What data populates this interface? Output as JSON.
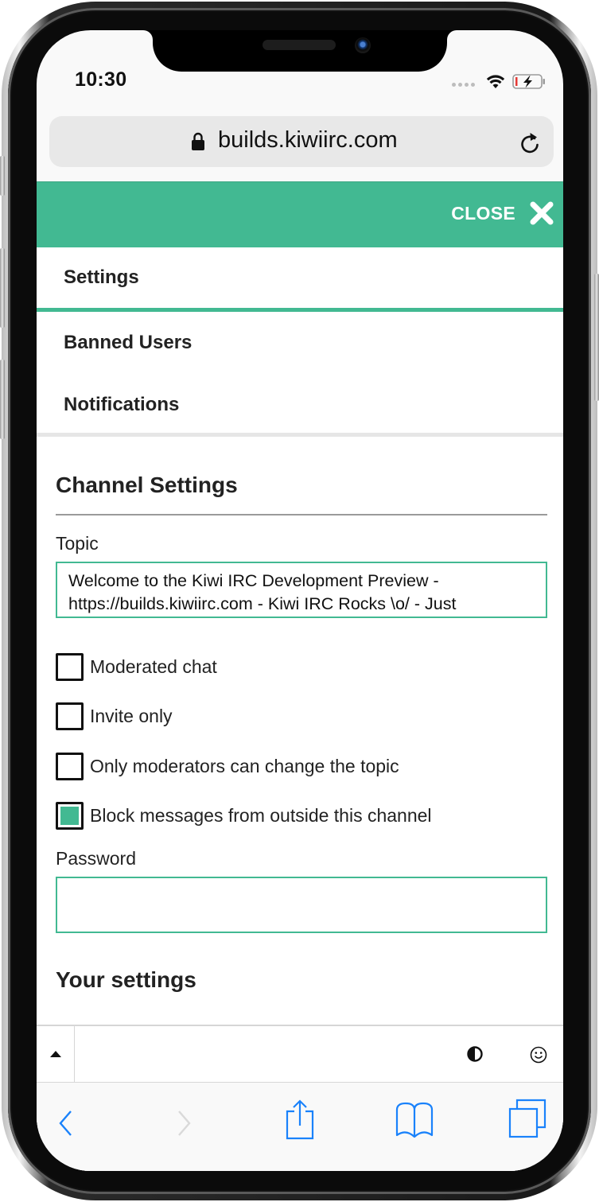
{
  "status_bar": {
    "time": "10:30"
  },
  "browser": {
    "url": "builds.kiwiirc.com",
    "icons": {
      "lock": "lock-icon",
      "reload": "reload-icon"
    },
    "toolbar": {
      "back": "back-icon",
      "forward": "forward-icon",
      "share": "share-icon",
      "bookmarks": "bookmarks-icon",
      "tabs": "tabs-icon"
    }
  },
  "theme": {
    "accent": "#42b992",
    "ios_blue": "#1a82fb"
  },
  "header": {
    "close_label": "CLOSE",
    "close_icon": "close-icon"
  },
  "tabs": [
    {
      "label": "Settings",
      "active": true
    },
    {
      "label": "Banned Users",
      "active": false
    },
    {
      "label": "Notifications",
      "active": false
    }
  ],
  "channel_settings": {
    "title": "Channel Settings",
    "topic_label": "Topic",
    "topic_value": "Welcome to the Kiwi IRC Development Preview - https://builds.kiwiirc.com - Kiwi IRC Rocks \\o/ - Just",
    "options": [
      {
        "label": "Moderated chat",
        "checked": false
      },
      {
        "label": "Invite only",
        "checked": false
      },
      {
        "label": "Only moderators can change the topic",
        "checked": false
      },
      {
        "label": "Block messages from outside this channel",
        "checked": true
      }
    ],
    "password_label": "Password",
    "password_value": ""
  },
  "your_settings": {
    "title": "Your settings"
  },
  "input_bar": {
    "expand_icon": "triangle-up-icon",
    "contrast_icon": "contrast-icon",
    "emoji_icon": "emoji-icon",
    "message_value": ""
  }
}
